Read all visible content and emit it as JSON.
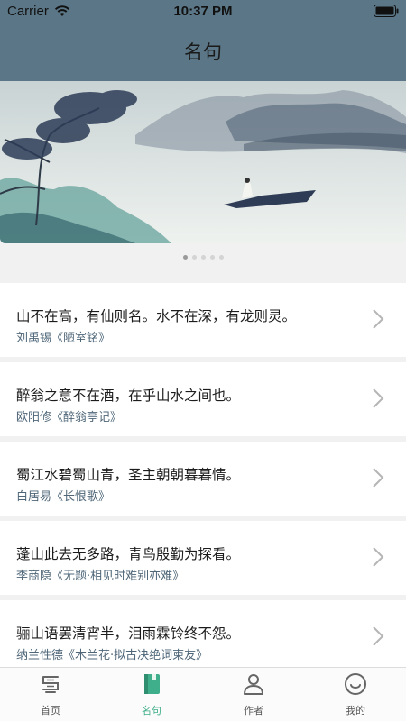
{
  "status_bar": {
    "carrier": "Carrier",
    "time": "10:37 PM"
  },
  "header": {
    "title": "名句"
  },
  "carousel": {
    "active_index": 0,
    "count": 5
  },
  "quotes": [
    {
      "text": "山不在高，有仙则名。水不在深，有龙则灵。",
      "source": "刘禹锡《陋室铭》"
    },
    {
      "text": "醉翁之意不在酒，在乎山水之间也。",
      "source": "欧阳修《醉翁亭记》"
    },
    {
      "text": "蜀江水碧蜀山青，圣主朝朝暮暮情。",
      "source": "白居易《长恨歌》"
    },
    {
      "text": "蓬山此去无多路，青鸟殷勤为探看。",
      "source": "李商隐《无题·相见时难别亦难》"
    },
    {
      "text": "骊山语罢清宵半，泪雨霖铃终不怨。",
      "source": "纳兰性德《木兰花·拟古决绝词柬友》"
    }
  ],
  "tabbar": {
    "tabs": [
      {
        "label": "首页",
        "icon": "home-icon"
      },
      {
        "label": "名句",
        "icon": "book-icon"
      },
      {
        "label": "作者",
        "icon": "person-icon"
      },
      {
        "label": "我的",
        "icon": "smile-icon"
      }
    ],
    "active_index": 1,
    "active_color": "#3fae8a"
  },
  "colors": {
    "header": "#5b7686",
    "accent": "#3fae8a"
  }
}
